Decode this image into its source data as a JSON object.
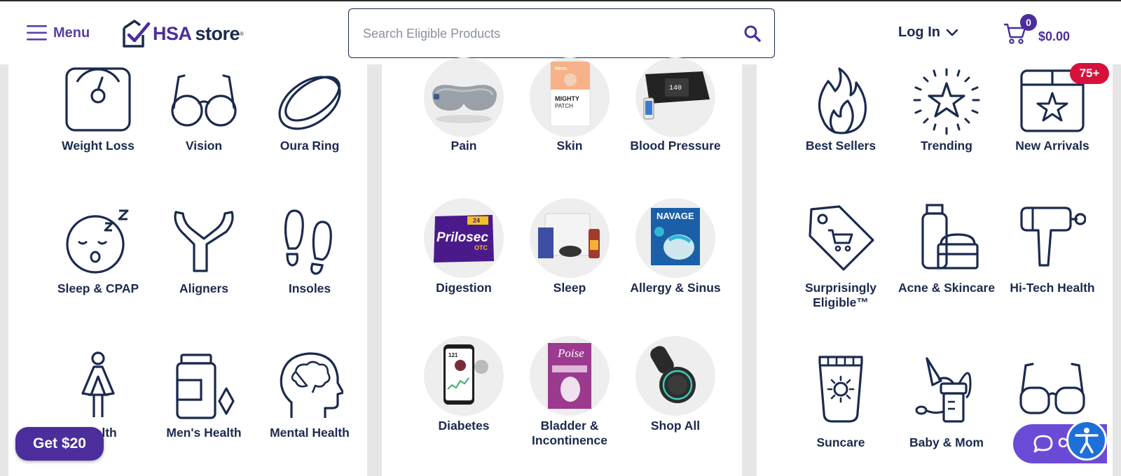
{
  "header": {
    "menu_label": "Menu",
    "logo_hsa": "HSA",
    "logo_store": "store",
    "logo_reg": "®",
    "search_placeholder": "Search Eligible Products",
    "login_label": "Log In",
    "cart_count": "0",
    "cart_total": "$0.00"
  },
  "panel_left": {
    "items": [
      {
        "label": "Weight Loss",
        "icon": "scale-icon"
      },
      {
        "label": "Vision",
        "icon": "glasses-icon"
      },
      {
        "label": "Oura Ring",
        "icon": "ring-icon"
      },
      {
        "label": "Sleep & CPAP",
        "icon": "sleeping-face-icon"
      },
      {
        "label": "Aligners",
        "icon": "aligner-icon"
      },
      {
        "label": "Insoles",
        "icon": "footprints-icon"
      },
      {
        "label": "Health",
        "icon": "woman-icon"
      },
      {
        "label": "Men's Health",
        "icon": "pill-bottle-icon"
      },
      {
        "label": "Mental Health",
        "icon": "brain-head-icon"
      }
    ]
  },
  "panel_middle": {
    "items": [
      {
        "label": "Pain",
        "image": "eye-massager-product"
      },
      {
        "label": "Skin",
        "image": "mighty-patch-product"
      },
      {
        "label": "Blood Pressure",
        "image": "blood-pressure-monitor-product"
      },
      {
        "label": "Digestion",
        "image": "prilosec-product"
      },
      {
        "label": "Sleep",
        "image": "sleep-kit-product"
      },
      {
        "label": "Allergy & Sinus",
        "image": "navage-product"
      },
      {
        "label": "Diabetes",
        "image": "glucose-app-phone-product"
      },
      {
        "label": "Bladder & Incontinence",
        "image": "poise-product"
      },
      {
        "label": "Shop All",
        "image": "device-product"
      }
    ],
    "product_text": {
      "mighty_brand": "Hero.",
      "mighty_title": "MIGHTY",
      "mighty_sub": "PATCH",
      "bp_reading": "140",
      "prilosec": "Prilosec",
      "prilosec_otc": "OTC",
      "prilosec_badge": "24",
      "navage": "NAVAGE",
      "poise": "Poise",
      "phone_value": "121"
    }
  },
  "panel_right": {
    "new_badge": "75+",
    "items": [
      {
        "label": "Best Sellers",
        "icon": "flame-icon"
      },
      {
        "label": "Trending",
        "icon": "star-burst-icon"
      },
      {
        "label": "New Arrivals",
        "icon": "star-box-icon"
      },
      {
        "label": "Surprisingly Eligible™",
        "icon": "tag-cart-icon"
      },
      {
        "label": "Acne & Skincare",
        "icon": "skincare-jar-icon"
      },
      {
        "label": "Hi-Tech Health",
        "icon": "massage-gun-icon"
      },
      {
        "label": "Suncare",
        "icon": "sunscreen-tube-icon"
      },
      {
        "label": "Baby & Mom",
        "icon": "breast-pump-icon"
      },
      {
        "label": "",
        "icon": "glasses-icon"
      }
    ]
  },
  "floating": {
    "get20_label": "Get $20",
    "chat_label": "Ch"
  },
  "colors": {
    "brand_purple": "#4b2e9c",
    "navy": "#1b2a4e",
    "badge_red": "#d6123b",
    "chat_purple": "#6b4bd6",
    "accessibility_blue": "#1e6fd9"
  }
}
